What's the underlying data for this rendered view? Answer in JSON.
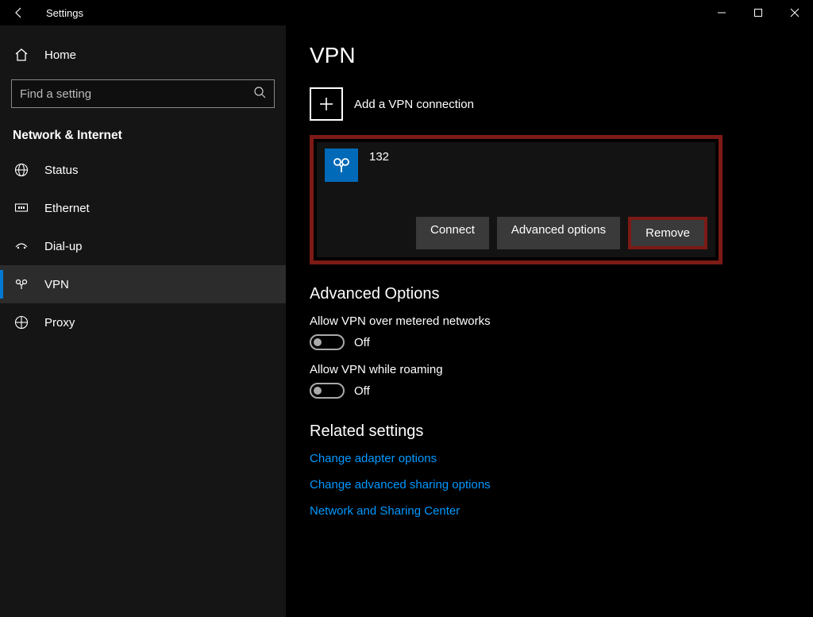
{
  "titlebar": {
    "title": "Settings"
  },
  "sidebar": {
    "home": "Home",
    "search_placeholder": "Find a setting",
    "section": "Network & Internet",
    "items": [
      {
        "label": "Status"
      },
      {
        "label": "Ethernet"
      },
      {
        "label": "Dial-up"
      },
      {
        "label": "VPN"
      },
      {
        "label": "Proxy"
      }
    ]
  },
  "main": {
    "title": "VPN",
    "add_label": "Add a VPN connection",
    "connection": {
      "name": "132",
      "connect": "Connect",
      "advanced": "Advanced options",
      "remove": "Remove"
    },
    "advanced_header": "Advanced Options",
    "options": [
      {
        "label": "Allow VPN over metered networks",
        "state": "Off"
      },
      {
        "label": "Allow VPN while roaming",
        "state": "Off"
      }
    ],
    "related_header": "Related settings",
    "links": [
      "Change adapter options",
      "Change advanced sharing options",
      "Network and Sharing Center"
    ]
  }
}
